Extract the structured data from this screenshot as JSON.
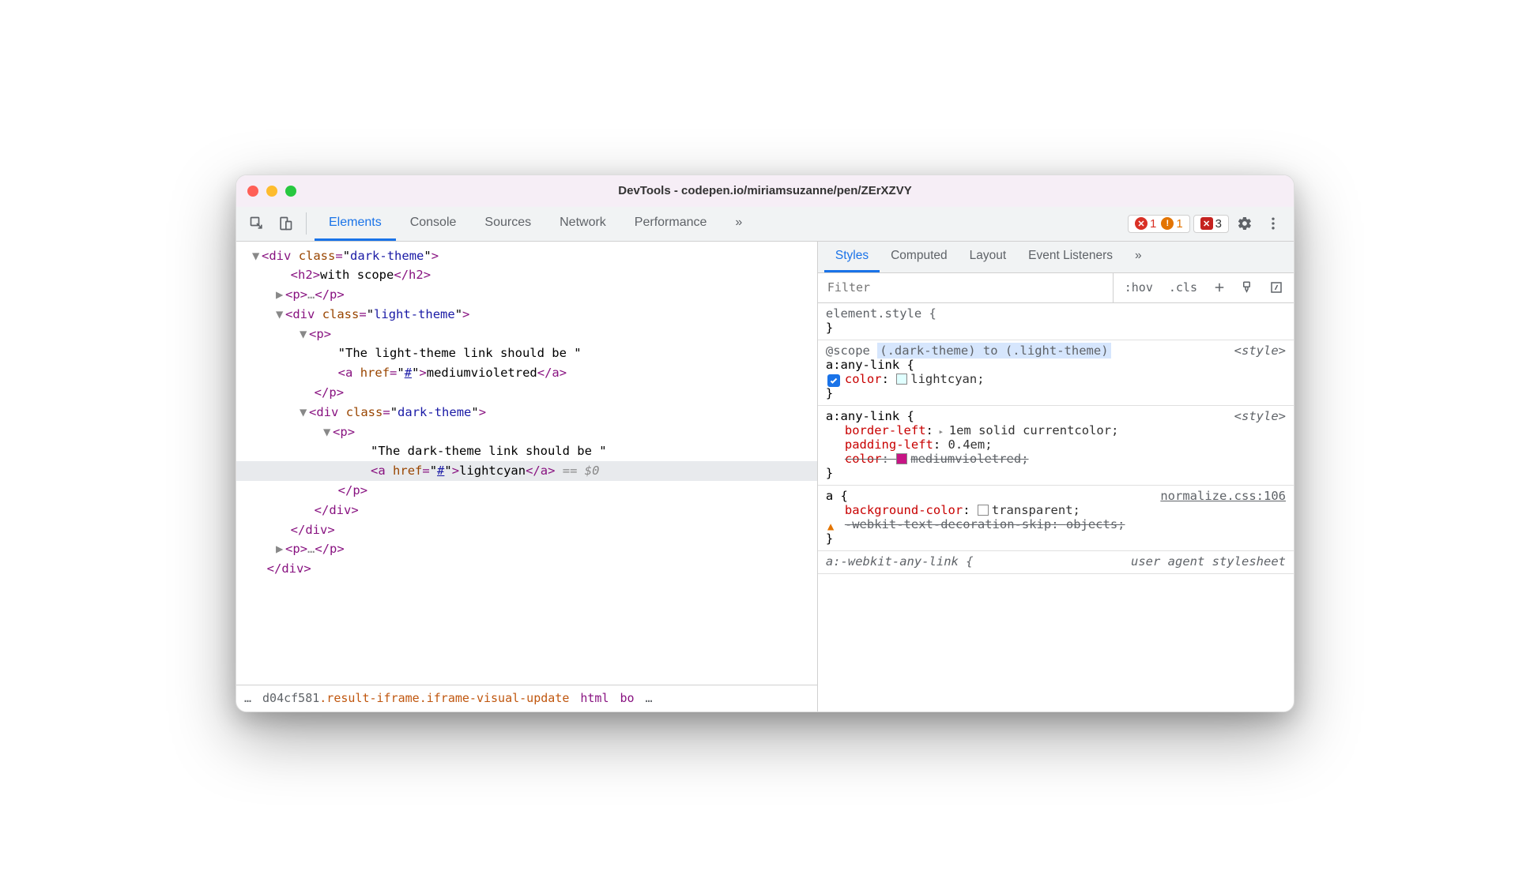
{
  "title": "DevTools - codepen.io/miriamsuzanne/pen/ZErXZVY",
  "toolbar": {
    "tabs": [
      "Elements",
      "Console",
      "Sources",
      "Network",
      "Performance"
    ],
    "more": "»",
    "errors": "1",
    "warnings": "1",
    "issues": "3"
  },
  "dom": {
    "l1": {
      "tag": "div",
      "attr": "class",
      "val": "dark-theme"
    },
    "l2": {
      "tag": "h2",
      "text": "with scope"
    },
    "l3": {
      "tag": "p",
      "ell": "…"
    },
    "l4": {
      "tag": "div",
      "attr": "class",
      "val": "light-theme"
    },
    "l5": {
      "tag": "p"
    },
    "l6": {
      "text": "\"The light-theme link should be \""
    },
    "l7": {
      "tag": "a",
      "attr": "href",
      "val": "#",
      "text": "mediumvioletred"
    },
    "l8": {
      "close": "p"
    },
    "l9": {
      "tag": "div",
      "attr": "class",
      "val": "dark-theme"
    },
    "l10": {
      "tag": "p"
    },
    "l11": {
      "text": "\"The dark-theme link should be \""
    },
    "l12": {
      "tag": "a",
      "attr": "href",
      "val": "#",
      "text": "lightcyan",
      "var": " == $0"
    },
    "l13": {
      "close": "p"
    },
    "l14": {
      "close": "div"
    },
    "l15": {
      "close": "div"
    },
    "l16": {
      "tag": "p",
      "ell": "…"
    },
    "l17": {
      "close": "div"
    }
  },
  "breadcrumb": {
    "pre": "…",
    "hash": "d04cf581",
    "iframe": ".result-iframe.iframe-visual-update",
    "html": "html",
    "body": "bo",
    "post": "…"
  },
  "subtabs": [
    "Styles",
    "Computed",
    "Layout",
    "Event Listeners"
  ],
  "subtabs_more": "»",
  "filter": {
    "placeholder": "Filter",
    "hov": ":hov",
    "cls": ".cls"
  },
  "styles": {
    "b0": {
      "selector": "element.style {",
      "close": "}"
    },
    "b1": {
      "scope_kw": "@scope",
      "scope_args": "(.dark-theme) to (.light-theme)",
      "selector": "a:any-link {",
      "src": "<style>",
      "prop": "color",
      "val": "lightcyan;",
      "close": "}"
    },
    "b2": {
      "selector": "a:any-link {",
      "src": "<style>",
      "p1": "border-left",
      "v1": "1em solid currentcolor;",
      "p2": "padding-left",
      "v2": "0.4em;",
      "p3": "color",
      "v3": "mediumvioletred;",
      "close": "}"
    },
    "b3": {
      "selector": "a {",
      "src": "normalize.css:106",
      "p1": "background-color",
      "v1": "transparent;",
      "p2": "-webkit-text-decoration-skip",
      "v2": "objects;",
      "close": "}"
    },
    "b4": {
      "selector": "a:-webkit-any-link {",
      "src": "user agent stylesheet"
    }
  }
}
